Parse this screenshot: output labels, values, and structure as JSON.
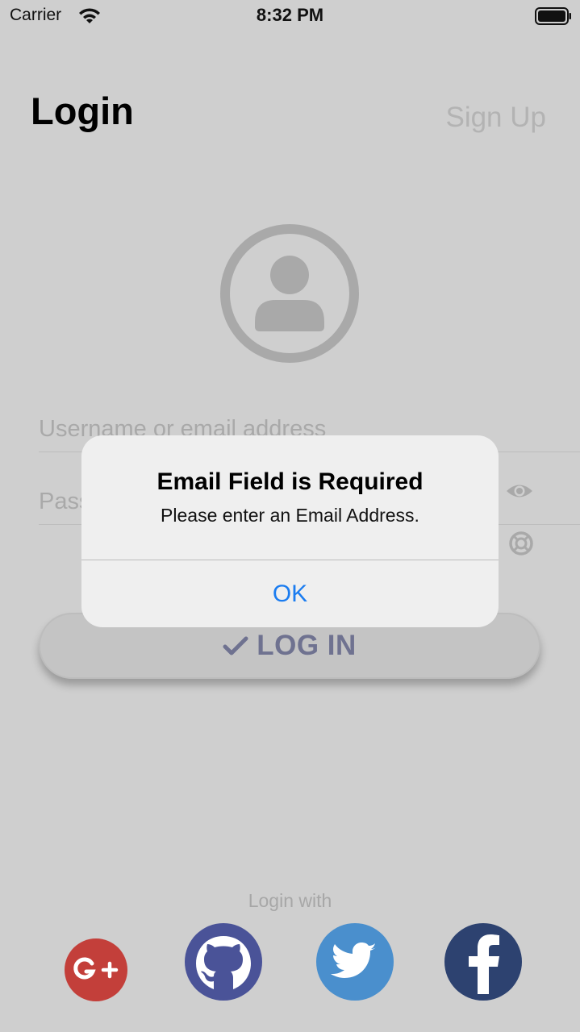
{
  "status_bar": {
    "carrier": "Carrier",
    "time": "8:32 PM"
  },
  "header": {
    "title": "Login",
    "signup_label": "Sign Up"
  },
  "form": {
    "username_placeholder": "Username or email address",
    "password_placeholder": "Password"
  },
  "login_button": {
    "label": "LOG IN"
  },
  "social": {
    "caption": "Login with",
    "providers": [
      "google-plus",
      "github",
      "twitter",
      "facebook"
    ]
  },
  "alert": {
    "title": "Email Field is Required",
    "message": "Please enter an Email Address.",
    "ok_label": "OK"
  },
  "colors": {
    "accent_blue": "#1a7cf0",
    "google": "#c33f3a",
    "github": "#4a5398",
    "twitter": "#4a8fcd",
    "facebook": "#2d4270"
  }
}
